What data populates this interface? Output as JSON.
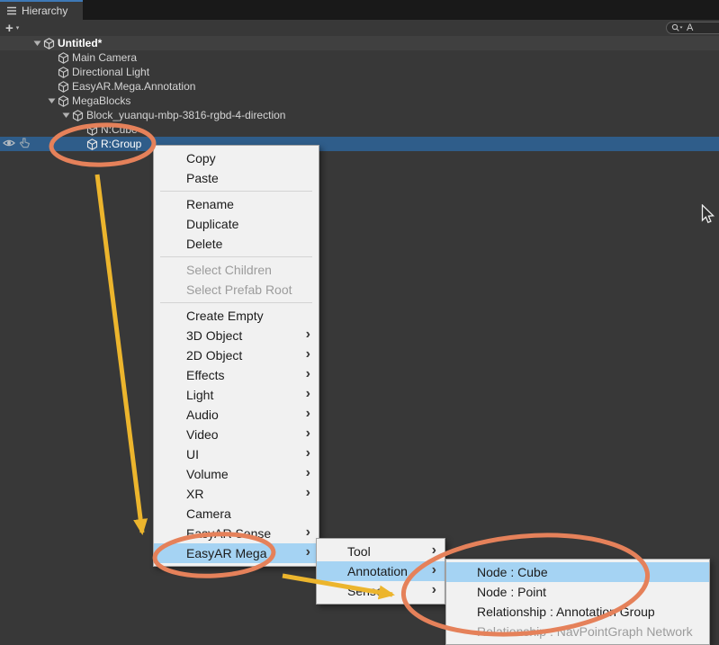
{
  "window": {
    "tab_title": "Hierarchy"
  },
  "toolbar": {
    "create_label": "+",
    "create_caret": "▾",
    "search_text": "A"
  },
  "hierarchy": {
    "scene": {
      "label": "Untitled*",
      "expanded": true
    },
    "items": [
      {
        "label": "Main Camera",
        "depth": 1,
        "icon": "cube"
      },
      {
        "label": "Directional Light",
        "depth": 1,
        "icon": "cube"
      },
      {
        "label": "EasyAR.Mega.Annotation",
        "depth": 1,
        "icon": "cube"
      },
      {
        "label": "MegaBlocks",
        "depth": 1,
        "icon": "cube",
        "expanded": true
      },
      {
        "label": "Block_yuanqu-mbp-3816-rgbd-4-direction",
        "depth": 2,
        "icon": "cube",
        "expanded": true
      },
      {
        "label": "N:Cube",
        "depth": 3,
        "icon": "cube"
      },
      {
        "label": "R:Group",
        "depth": 3,
        "icon": "cube",
        "selected": true
      }
    ]
  },
  "context_menu": {
    "items": [
      {
        "label": "Copy"
      },
      {
        "label": "Paste"
      },
      {
        "type": "separator"
      },
      {
        "label": "Rename"
      },
      {
        "label": "Duplicate"
      },
      {
        "label": "Delete"
      },
      {
        "type": "separator"
      },
      {
        "label": "Select Children",
        "disabled": true
      },
      {
        "label": "Select Prefab Root",
        "disabled": true
      },
      {
        "type": "separator"
      },
      {
        "label": "Create Empty"
      },
      {
        "label": "3D Object",
        "submenu": true
      },
      {
        "label": "2D Object",
        "submenu": true
      },
      {
        "label": "Effects",
        "submenu": true
      },
      {
        "label": "Light",
        "submenu": true
      },
      {
        "label": "Audio",
        "submenu": true
      },
      {
        "label": "Video",
        "submenu": true
      },
      {
        "label": "UI",
        "submenu": true
      },
      {
        "label": "Volume",
        "submenu": true
      },
      {
        "label": "XR",
        "submenu": true
      },
      {
        "label": "Camera"
      },
      {
        "label": "EasyAR Sense",
        "submenu": true
      },
      {
        "label": "EasyAR Mega",
        "submenu": true,
        "highlighted": true
      }
    ]
  },
  "submenu_mega": {
    "items": [
      {
        "label": "Tool",
        "submenu": true
      },
      {
        "label": "Annotation",
        "submenu": true,
        "highlighted": true
      },
      {
        "label": "Sense",
        "submenu": true
      }
    ]
  },
  "submenu_annotation": {
    "items": [
      {
        "label": "Node : Cube",
        "highlighted": true
      },
      {
        "label": "Node : Point"
      },
      {
        "label": "Relationship : Annotation Group"
      },
      {
        "label": "Relationship : NavPointGraph Network",
        "disabled": true
      }
    ]
  },
  "icons": {
    "submenu_arrow": "›"
  },
  "colors": {
    "panel_bg": "#383838",
    "tabbar_bg": "#191919",
    "tab_accent": "#3e79b6",
    "scene_row_bg": "#404040",
    "sel_blue": "#2f5d8a",
    "hier_text": "#d4d4d4",
    "menu_bg": "#f1f1f1",
    "menu_border": "#a3a3a3",
    "menu_text": "#1b1b1b",
    "menu_disabled": "#9c9c9c",
    "menu_hl": "#a5d3f3",
    "annotation_orange": "#e5815a",
    "annotation_yellow": "#ecb52d"
  }
}
